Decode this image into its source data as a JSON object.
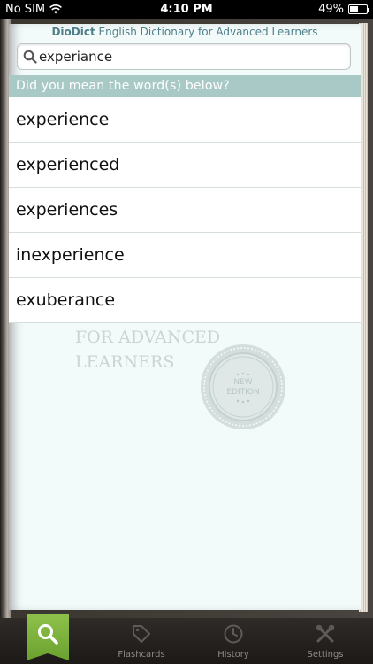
{
  "status_bar": {
    "carrier": "No SIM",
    "time": "4:10 PM",
    "battery": "49%",
    "battery_level": 0.49
  },
  "app": {
    "brand": "DioDict",
    "subtitle": "English Dictionary for Advanced Learners"
  },
  "search": {
    "value": "experiance"
  },
  "suggestions": {
    "header": "Did you mean the word(s) below?",
    "items": [
      "experience",
      "experienced",
      "experiences",
      "inexperience",
      "exuberance"
    ]
  },
  "watermark": {
    "line1": "FOR ADVANCED",
    "line2": "LEARNERS",
    "seal_line1": "NEW",
    "seal_line2": "EDITION"
  },
  "tabs": {
    "search": {
      "icon": "search-icon",
      "active": true
    },
    "flashcards": {
      "label": "Flashcards",
      "icon": "tag-icon"
    },
    "history": {
      "label": "History",
      "icon": "clock-icon"
    },
    "settings": {
      "label": "Settings",
      "icon": "tools-icon"
    }
  },
  "colors": {
    "accent_green": "#7bb23c",
    "header_teal": "#a9c9c7",
    "title_teal": "#4e7f8a"
  }
}
